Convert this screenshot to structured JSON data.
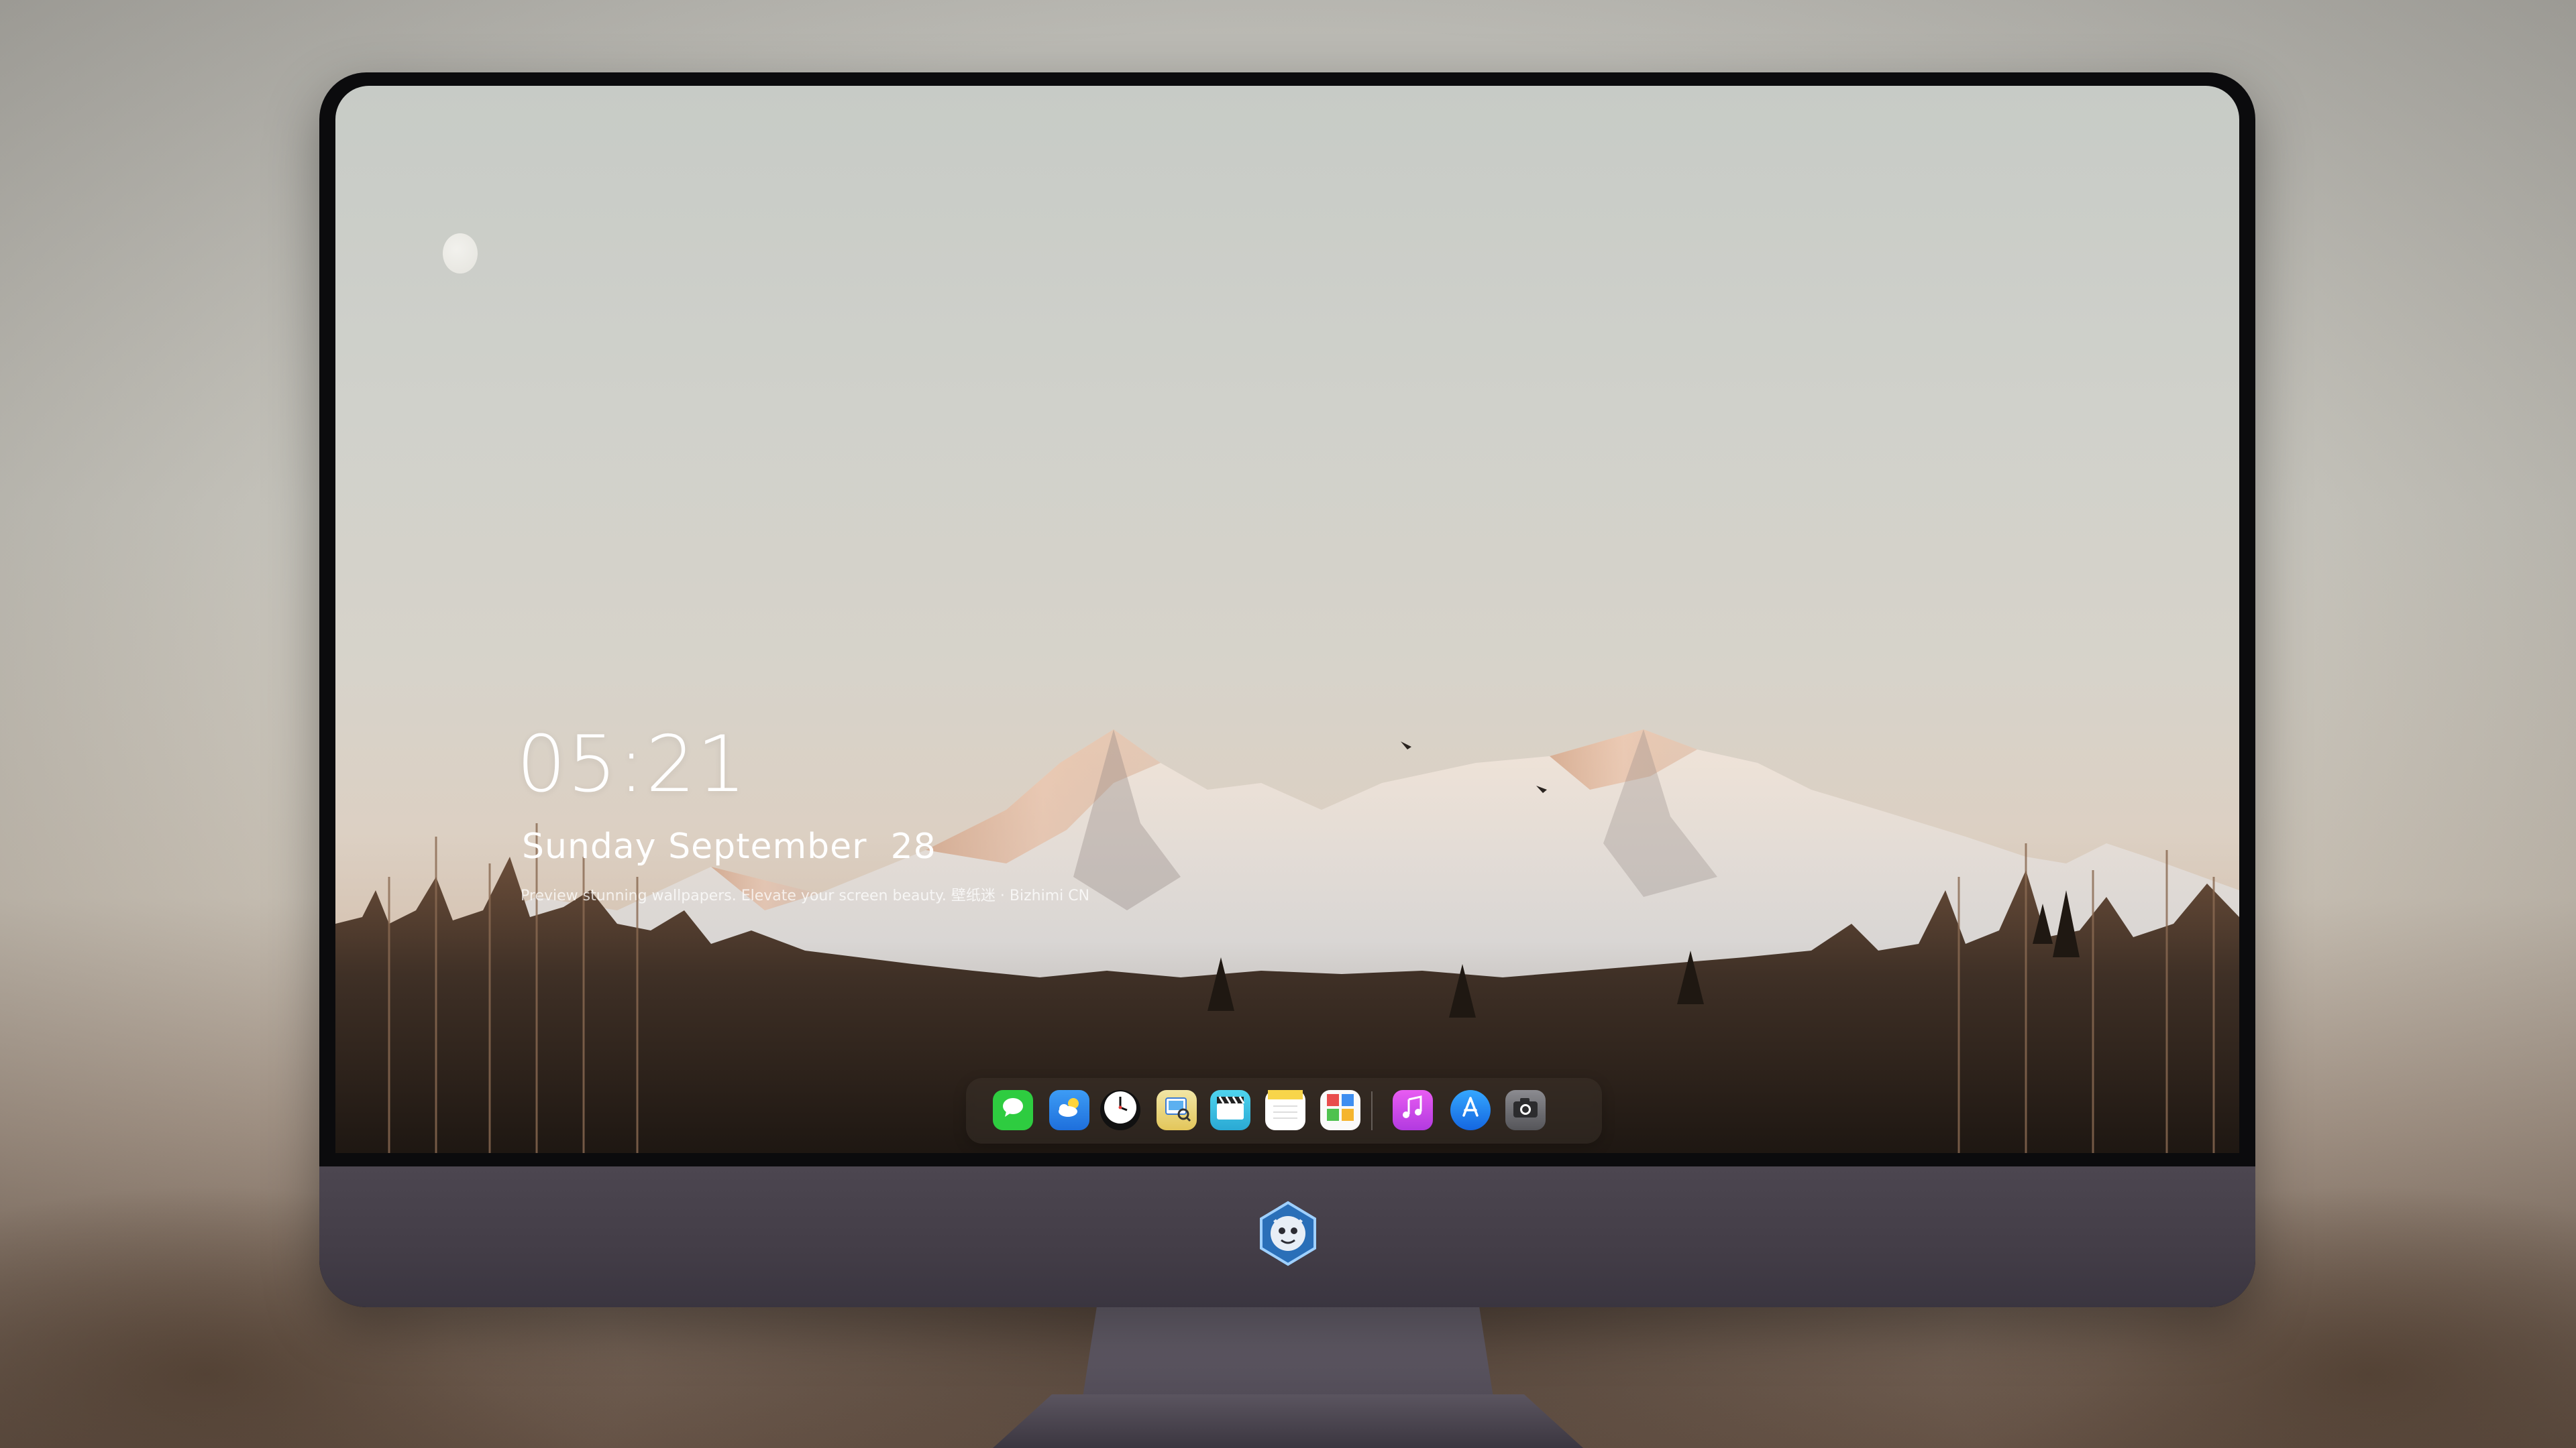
{
  "lock_screen": {
    "time": "05:21",
    "date": "Sunday September  28",
    "caption": "Preview stunning wallpapers. Elevate your screen beauty. 壁纸迷 · Bizhimi CN"
  },
  "dock": {
    "apps": [
      {
        "name": "Messages",
        "icon": "message-bubble-icon",
        "color": "#2ecc40"
      },
      {
        "name": "Weather",
        "icon": "cloud-sun-icon",
        "color": "#2f8ff0"
      },
      {
        "name": "Clock",
        "icon": "clock-icon",
        "color": "#ffffff"
      },
      {
        "name": "Preview",
        "icon": "preview-icon",
        "color": "#e9d36a"
      },
      {
        "name": "Clips",
        "icon": "clapperboard-icon",
        "color": "#3ec7e8"
      },
      {
        "name": "Notes",
        "icon": "notes-icon",
        "color": "#f8d54a"
      },
      {
        "name": "Photo Booth",
        "icon": "photo-grid-icon",
        "color": "#e94d4d"
      },
      {
        "name": "Music",
        "icon": "music-note-icon",
        "color": "#d84cf0"
      },
      {
        "name": "App Store",
        "icon": "app-store-icon",
        "color": "#1e8cf5"
      },
      {
        "name": "Camera",
        "icon": "camera-icon",
        "color": "#6e6e72"
      }
    ]
  },
  "colors": {
    "sky_top": "#c7cbc6",
    "sky_bottom": "#dcd0c3",
    "monitor_chin": "#433d47",
    "bezel": "#0b0b0d"
  }
}
